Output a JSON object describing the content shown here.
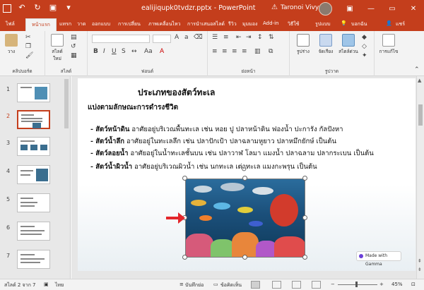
{
  "titlebar": {
    "filename": "ealijiqupk0tvdzr.pptx",
    "separator": "-",
    "app": "PowerPoint",
    "warning": "⚠",
    "user": "Taronoi Vivy",
    "win_min": "—",
    "win_max": "▭",
    "win_close": "✕"
  },
  "tabs": [
    "ไฟล์",
    "หน้าแรก",
    "แทรก",
    "วาด",
    "ออกแบบ",
    "การเปลี่ยน",
    "ภาพเคลื่อนไหว",
    "การนำเสนอสไลด์",
    "รีวิว",
    "มุมมอง",
    "Add-in",
    "วิธีใช้",
    "รูปแบบ"
  ],
  "tab_tell": "บอกฉัน",
  "tab_share": "แชร์",
  "ribbon": {
    "paste": "วาง",
    "clipboard": "คลิปบอร์ด",
    "new_slide": "สไลด์ใหม่",
    "slides": "สไลด์",
    "font": "ฟอนต์",
    "paragraph": "ย่อหน้า",
    "shapes": "รูปร่าง",
    "arrange": "จัดเรียง",
    "quick_styles": "สไตล์ด่วน",
    "drawing": "รูปวาด",
    "editing": "การแก้ไข"
  },
  "thumbnails": [
    "1",
    "2",
    "3",
    "4",
    "5",
    "6",
    "7"
  ],
  "selected_slide": 2,
  "slide": {
    "title": "ประเภทของสัตว์ทะเล",
    "subtitle": "แบ่งตามลักษณะการดำรงชีวิต",
    "bullets": [
      {
        "bold": "- สัตว์หน้าดิน",
        "text": " อาศัยอยู่บริเวณพื้นทะเล เช่น หอย ปู ปลาหน้าดิน ฟองน้ำ ปะการัง กัลปังหา"
      },
      {
        "bold": "- สัตว์น้ำลึก",
        "text": " อาศัยอยู่ในทะเลลึก เช่น ปลาปักเป้า ปลาฉลามหูยาว ปลาหมึกยักษ์ เป็นต้น"
      },
      {
        "bold": "- สัตว์ลอยน้ำ",
        "text": " อาศัยอยู่ในน้ำทะเลชั้นบน เช่น ปลาวาฬ โลมา แมงน้ำ ปลาฉลาม ปลากระเบน เป็นต้น"
      },
      {
        "bold": "- สัตว์น้ำผิวน้ำ",
        "text": " อาศัยอยู่บริเวณผิวน้ำ เช่น นกทะเล เต่าทะเล แมงกะพรุน เป็นต้น"
      }
    ],
    "badge": "Made with Gamma"
  },
  "statusbar": {
    "slide_info": "สไลด์ 2 จาก 7",
    "lang": "ไทย",
    "notes": "บันทึกย่อ",
    "comments": "ข้อคิดเห็น",
    "zoom_minus": "−",
    "zoom_plus": "+",
    "zoom": "45%"
  }
}
